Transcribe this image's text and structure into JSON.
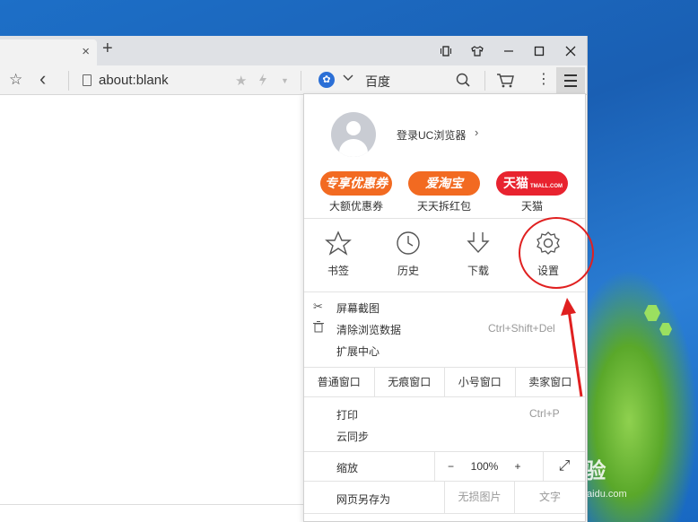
{
  "desktop": {
    "watermark": "Bai经验",
    "watermark_sub": "jingyan.baidu.com"
  },
  "tabbar": {
    "close": "×",
    "new_tab": "+"
  },
  "window_controls": {
    "pin": "▯",
    "shirt": "♧",
    "minimize": "—",
    "maximize": "☐",
    "close": "✕"
  },
  "toolbar": {
    "address": "about:blank",
    "search_engine": "百度",
    "star": "☆",
    "back": "‹"
  },
  "menu": {
    "login": "登录UC浏览器",
    "login_chevron": "›",
    "promos": [
      {
        "text": "专享优惠券",
        "label": "大额优惠券",
        "color": "#f26a21"
      },
      {
        "text": "爱淘宝",
        "label": "天天拆红包",
        "color": "#f26a21"
      },
      {
        "text": "天猫",
        "label": "天猫",
        "badge": "TMALL.COM",
        "color": "#e8232f"
      }
    ],
    "big_items": [
      "书签",
      "历史",
      "下载",
      "设置"
    ],
    "list1": [
      {
        "label": "屏幕截图",
        "icon": "✂",
        "shortcut": ""
      },
      {
        "label": "清除浏览数据",
        "icon": "🗑",
        "shortcut": "Ctrl+Shift+Del"
      },
      {
        "label": "扩展中心",
        "icon": "",
        "shortcut": ""
      }
    ],
    "windows": [
      "普通窗口",
      "无痕窗口",
      "小号窗口",
      "卖家窗口"
    ],
    "list2": [
      {
        "label": "打印",
        "shortcut": "Ctrl+P"
      },
      {
        "label": "云同步",
        "shortcut": ""
      }
    ],
    "zoom": {
      "label": "缩放",
      "minus": "−",
      "value": "100%",
      "plus": "+",
      "fullscreen": "⤢"
    },
    "save_row": {
      "label": "网页另存为",
      "no_images": "无损图片",
      "text": "文字"
    }
  },
  "colors": {
    "accent_red": "#e02020",
    "promo_orange": "#f26a21",
    "tmall_red": "#e8232f"
  }
}
